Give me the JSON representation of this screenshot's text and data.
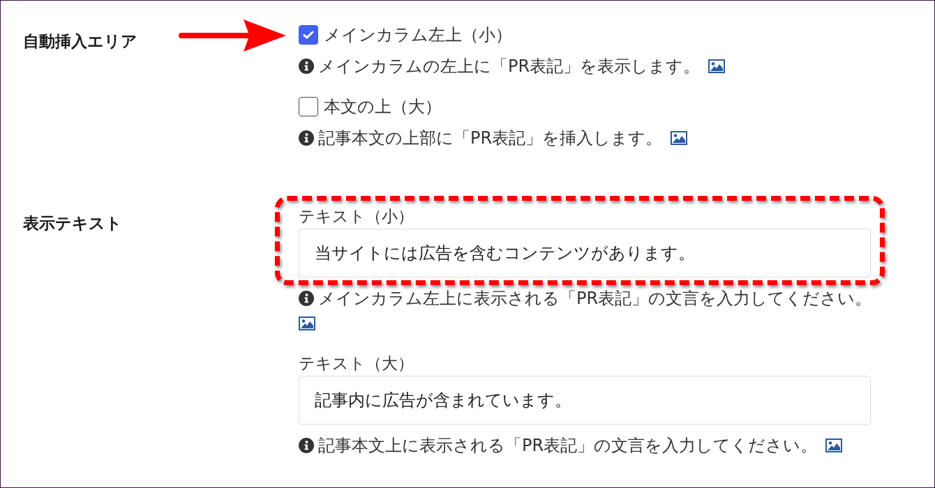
{
  "sections": [
    {
      "label": "自動挿入エリア",
      "arrow": true,
      "kind": "checkboxes",
      "options": [
        {
          "label": "メインカラム左上（小）",
          "checked": true,
          "help": "メインカラムの左上に「PR表記」を表示します。"
        },
        {
          "label": "本文の上（大）",
          "checked": false,
          "help": "記事本文の上部に「PR表記」を挿入します。"
        }
      ]
    },
    {
      "label": "表示テキスト",
      "arrow": false,
      "kind": "text_fields",
      "fields": [
        {
          "label": "テキスト（小）",
          "value": "当サイトには広告を含むコンテンツがあります。",
          "highlighted": true,
          "help": "メインカラム左上に表示される「PR表記」の文言を入力してください。"
        },
        {
          "label": "テキスト（大）",
          "value": "記事内に広告が含まれています。",
          "highlighted": false,
          "help": "記事本文上に表示される「PR表記」の文言を入力してください。"
        }
      ]
    }
  ]
}
